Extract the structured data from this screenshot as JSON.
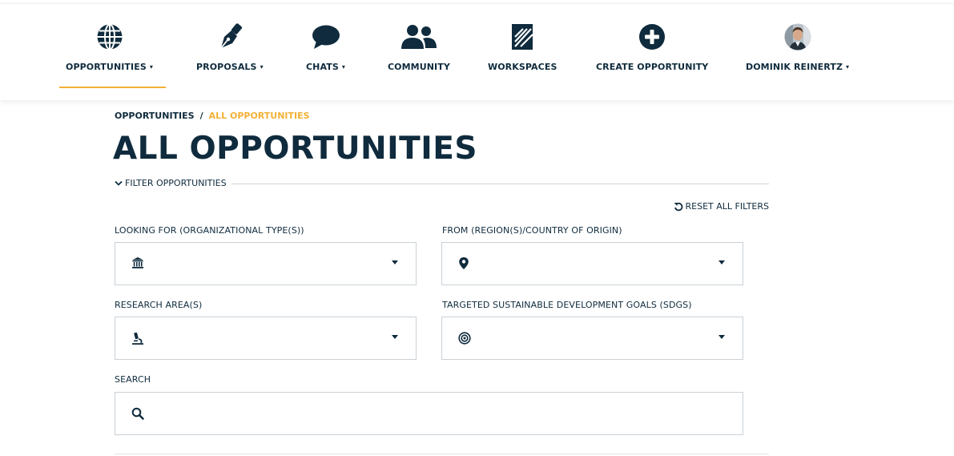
{
  "nav": {
    "items": [
      {
        "label": "OPPORTUNITIES",
        "icon": "globe-icon",
        "has_dropdown": true,
        "active": true
      },
      {
        "label": "PROPOSALS",
        "icon": "pen-nib-icon",
        "has_dropdown": true
      },
      {
        "label": "CHATS",
        "icon": "chat-bubble-icon",
        "has_dropdown": true
      },
      {
        "label": "COMMUNITY",
        "icon": "users-icon",
        "has_dropdown": false
      },
      {
        "label": "WORKSPACES",
        "icon": "workspaces-icon",
        "has_dropdown": false
      },
      {
        "label": "CREATE OPPORTUNITY",
        "icon": "plus-circle-icon",
        "has_dropdown": false
      },
      {
        "label": "DOMINIK REINERTZ",
        "icon": "avatar",
        "has_dropdown": true
      }
    ],
    "caret": "▾"
  },
  "breadcrumb": {
    "items": [
      "OPPORTUNITIES",
      "ALL OPPORTUNITIES"
    ],
    "separator": "/"
  },
  "page_title": "ALL OPPORTUNITIES",
  "filters": {
    "toggle_label": "FILTER OPPORTUNITIES",
    "reset_label": "RESET ALL FILTERS",
    "fields": [
      {
        "label": "LOOKING FOR (ORGANIZATIONAL TYPE(S))",
        "icon": "institution-icon",
        "value": ""
      },
      {
        "label": "FROM (REGION(S)/COUNTRY OF ORIGIN)",
        "icon": "map-marker-icon",
        "value": ""
      },
      {
        "label": "RESEARCH AREA(S)",
        "icon": "microscope-icon",
        "value": ""
      },
      {
        "label": "TARGETED SUSTAINABLE DEVELOPMENT GOALS (SDGS)",
        "icon": "target-icon",
        "value": ""
      }
    ],
    "search": {
      "label": "SEARCH",
      "icon": "search-icon",
      "value": "",
      "placeholder": ""
    }
  },
  "colors": {
    "navy": "#0f2b3d",
    "accent": "#f2b136",
    "border": "#c9d1d6"
  }
}
